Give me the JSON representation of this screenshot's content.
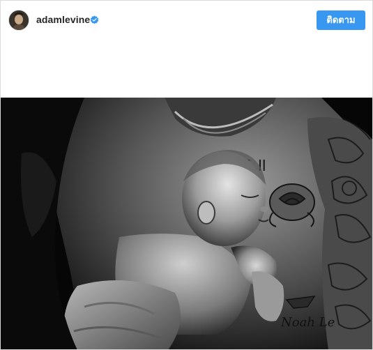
{
  "header": {
    "username": "adamlevine",
    "verified": true,
    "verified_icon": "verified-badge-icon",
    "follow_label": "ติดตาม",
    "follow_color": "#3897f0"
  },
  "post": {
    "photo_tattoo_text_1": "स ॥",
    "photo_tattoo_text_2": "Noah Le",
    "photo_style": "black-and-white"
  }
}
